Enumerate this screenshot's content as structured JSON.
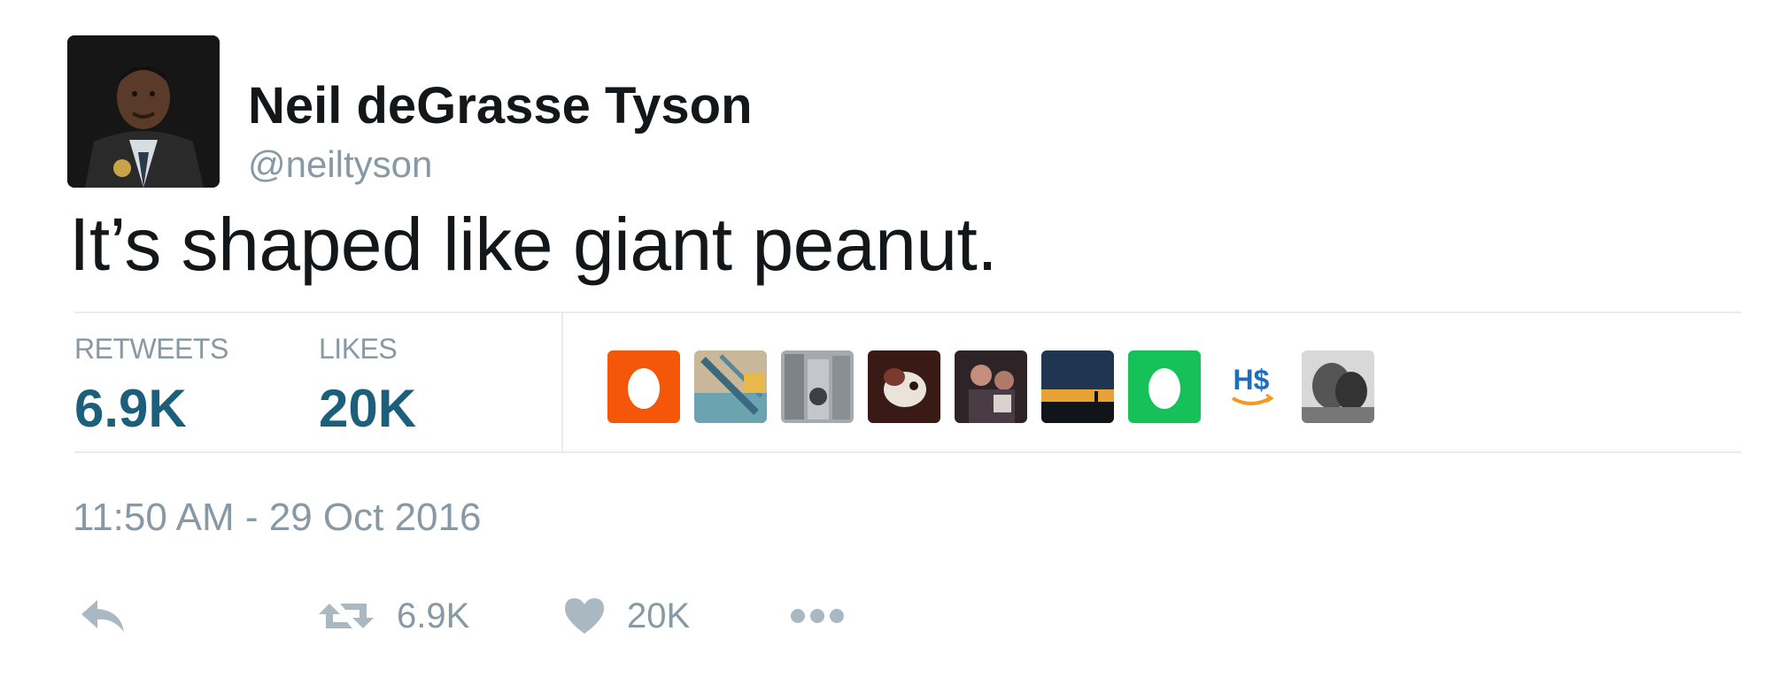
{
  "author": {
    "display_name": "Neil deGrasse Tyson",
    "handle": "@neiltyson",
    "avatar": "profile-photo"
  },
  "tweet": {
    "text": "It’s shaped like giant peanut.",
    "timestamp": "11:50 AM - 29 Oct 2016"
  },
  "stats": {
    "retweets_label": "RETWEETS",
    "retweets_value": "6.9K",
    "likes_label": "LIKES",
    "likes_value": "20K"
  },
  "likers": [
    {
      "kind": "egg",
      "color": "#f5570a"
    },
    {
      "kind": "photo",
      "color": "#6ba3b0"
    },
    {
      "kind": "photo",
      "color": "#8a8f96"
    },
    {
      "kind": "photo",
      "color": "#7a3b2e"
    },
    {
      "kind": "photo",
      "color": "#4a3c44"
    },
    {
      "kind": "photo",
      "color": "#1f3552"
    },
    {
      "kind": "egg",
      "color": "#17c15a"
    },
    {
      "kind": "logo",
      "text": "H$",
      "color": "#1a6fbf"
    },
    {
      "kind": "photo",
      "color": "#555555"
    }
  ],
  "actions": {
    "reply_icon": "reply-icon",
    "retweet_icon": "retweet-icon",
    "retweet_count": "6.9K",
    "like_icon": "heart-icon",
    "like_count": "20K",
    "more_icon": "more-dots-icon"
  },
  "colors": {
    "text_primary": "#14171a",
    "text_secondary": "#8899a6",
    "stat_value": "#1b5f7d",
    "divider": "#e6ecf0"
  }
}
